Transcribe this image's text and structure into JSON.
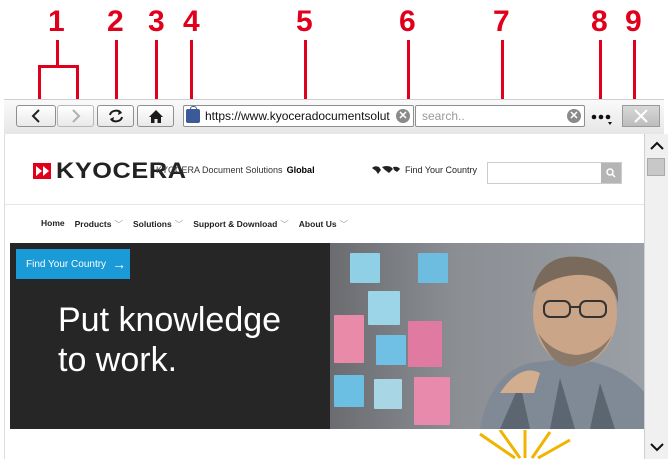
{
  "callouts": [
    "1",
    "2",
    "3",
    "4",
    "5",
    "6",
    "7",
    "8",
    "9"
  ],
  "toolbar": {
    "back_icon": "chevron-left-icon",
    "forward_icon": "chevron-right-icon",
    "refresh_icon": "refresh-icon",
    "home_icon": "home-icon",
    "lock_icon": "lock-icon",
    "url": "https://www.kyoceradocumentsolut",
    "search_placeholder": "search..",
    "more_icon": "more-icon",
    "close_icon": "close-icon"
  },
  "site": {
    "logo": "KYOCERA",
    "tagline": "KYOCERA Document Solutions",
    "tagline_region": "Global",
    "find_country": "Find Your Country",
    "nav": [
      "Home",
      "Products",
      "Solutions",
      "Support & Download",
      "About Us"
    ],
    "hero_cta": "Find Your Country",
    "hero_cta_arrow": "→",
    "hero_line1": "Put knowledge",
    "hero_line2": "to work."
  },
  "colors": {
    "accent": "#e0001b",
    "cta": "#1a9ad6",
    "hero_bg": "#262626"
  }
}
